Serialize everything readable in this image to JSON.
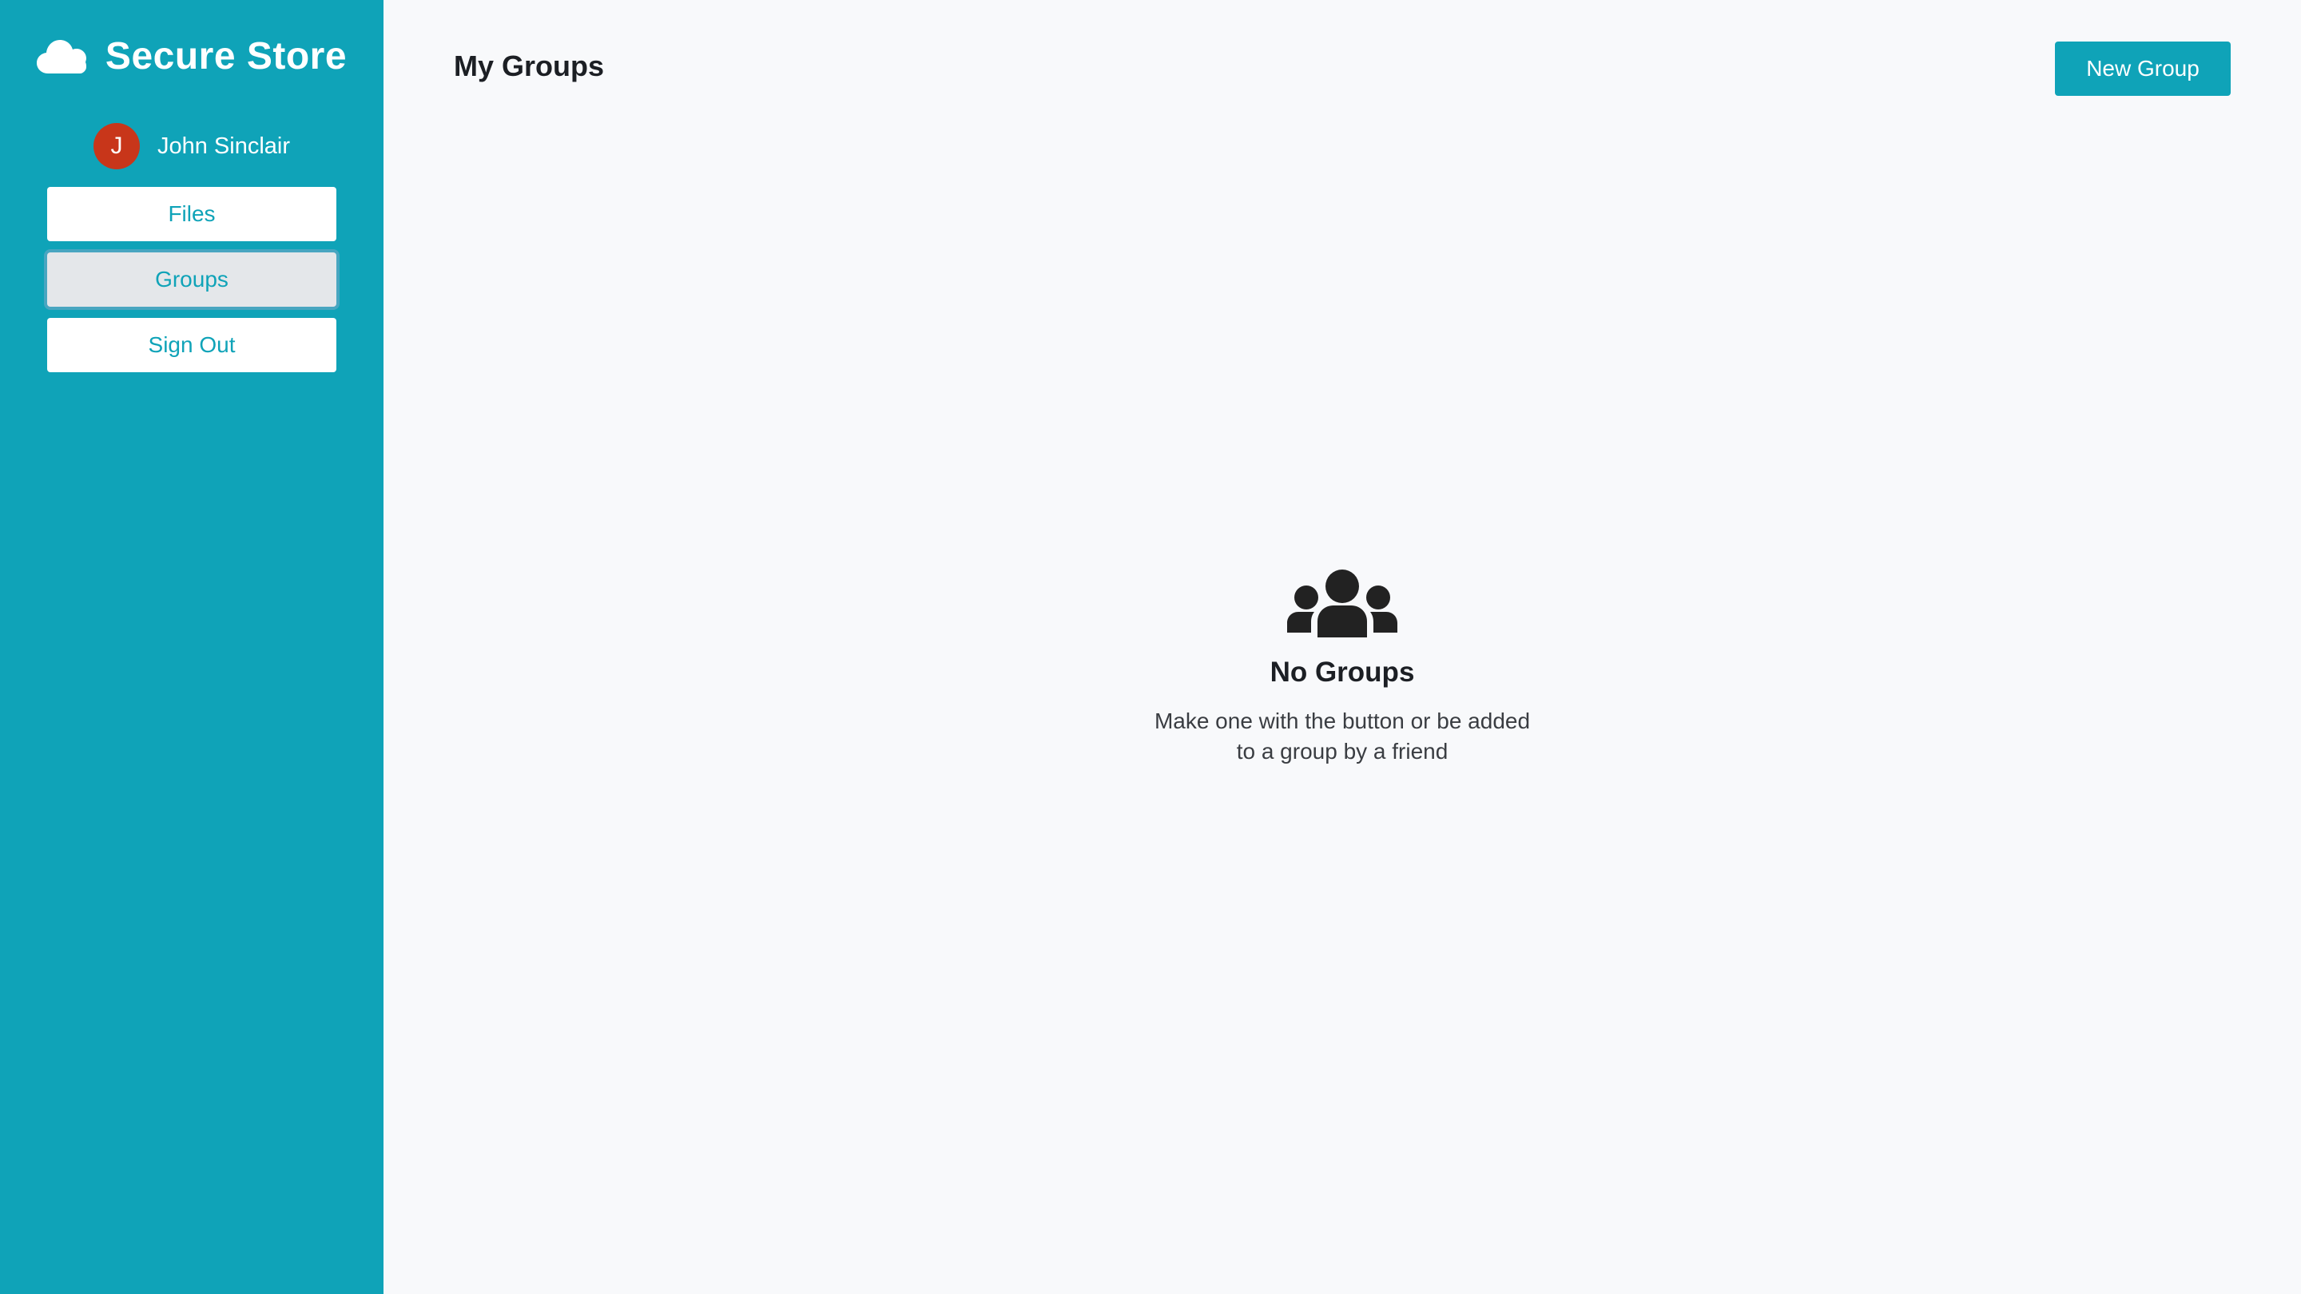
{
  "sidebar": {
    "brand": {
      "icon": "cloud-icon",
      "title": "Secure Store"
    },
    "user": {
      "initial": "J",
      "name": "John Sinclair",
      "avatar_color": "#c8361a"
    },
    "nav": [
      {
        "label": "Files",
        "active": false
      },
      {
        "label": "Groups",
        "active": true
      },
      {
        "label": "Sign Out",
        "active": false
      }
    ],
    "accent_color": "#0fa3b8"
  },
  "main": {
    "title": "My Groups",
    "new_group_label": "New Group",
    "empty_state": {
      "icon": "users-icon",
      "title": "No Groups",
      "message_line1": "Make one with the button or be added",
      "message_line2": "to a group by a friend"
    }
  }
}
